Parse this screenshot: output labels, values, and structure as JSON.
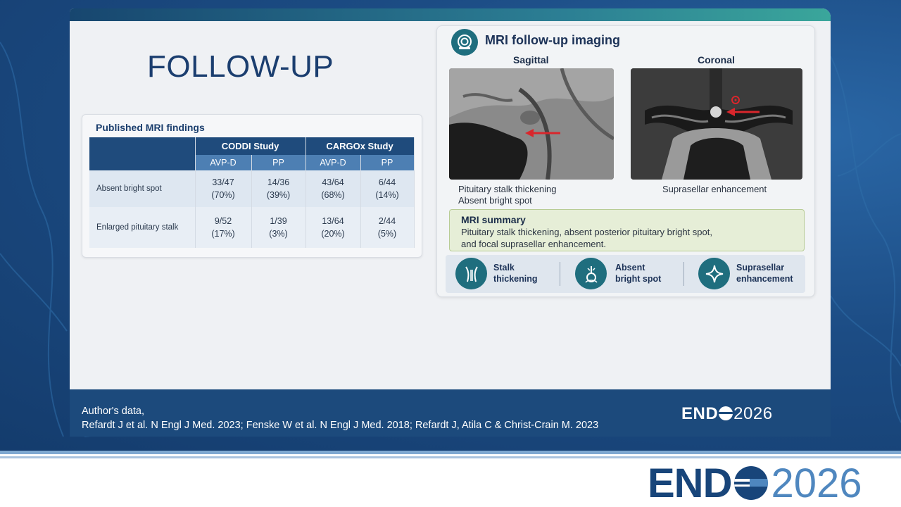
{
  "slide": {
    "title": "FOLLOW-UP"
  },
  "table": {
    "title": "Published MRI findings",
    "studies": [
      "CODDI Study",
      "CARGOx Study"
    ],
    "subheaders": [
      "AVP-D",
      "PP",
      "AVP-D",
      "PP"
    ],
    "rows": [
      {
        "label": "Absent bright spot",
        "cells": [
          [
            "33/47",
            "(70%)"
          ],
          [
            "14/36",
            "(39%)"
          ],
          [
            "43/64",
            "(68%)"
          ],
          [
            "6/44",
            "(14%)"
          ]
        ]
      },
      {
        "label": "Enlarged pituitary stalk",
        "cells": [
          [
            "9/52",
            "(17%)"
          ],
          [
            "1/39",
            "(3%)"
          ],
          [
            "13/64",
            "(20%)"
          ],
          [
            "2/44",
            "(5%)"
          ]
        ]
      }
    ]
  },
  "mri": {
    "title": "MRI follow-up imaging",
    "sagittal_label": "Sagittal",
    "coronal_label": "Coronal",
    "sagittal_caption_1": "Pituitary stalk thickening",
    "sagittal_caption_2": "Absent bright spot",
    "coronal_caption": "Suprasellar enhancement",
    "summary_title": "MRI summary",
    "summary_text": "Pituitary stalk thickening, absent posterior pituitary bright spot, and focal suprasellar enhancement.",
    "features": [
      {
        "line1": "Stalk",
        "line2": "thickening",
        "icon": "stalk-icon"
      },
      {
        "line1": "Absent",
        "line2": "bright spot",
        "icon": "pituitary-icon"
      },
      {
        "line1": "Suprasellar",
        "line2": "enhancement",
        "icon": "sparkle-icon"
      }
    ]
  },
  "footer": {
    "line1": "Author's data,",
    "line2": "Refardt J et al. N Engl J Med. 2023; Fenske W et al. N Engl J Med. 2018; Refardt J, Atila C & Christ-Crain M. 2023",
    "logo_bold": "END",
    "logo_year": "2026"
  },
  "banner": {
    "logo_bold": "END",
    "logo_year": "2026"
  },
  "colors": {
    "navy": "#1f4b7c",
    "teal": "#1f6e7e",
    "arrow_red": "#d9262c"
  }
}
